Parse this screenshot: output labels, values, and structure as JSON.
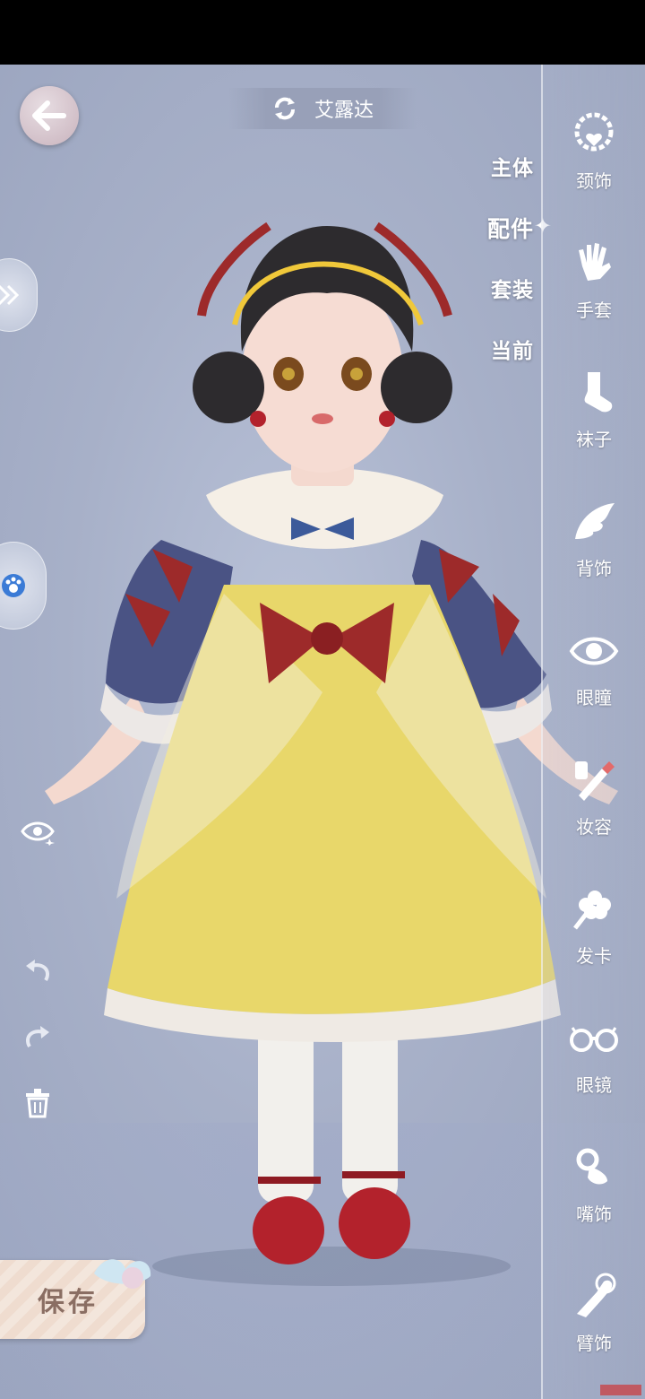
{
  "header": {
    "character_name": "艾露达"
  },
  "categories": [
    {
      "label": "主体",
      "active": false
    },
    {
      "label": "配件",
      "active": true
    },
    {
      "label": "套装",
      "active": false
    },
    {
      "label": "当前",
      "active": false
    }
  ],
  "rail": [
    {
      "label": "颈饰",
      "icon": "necklace-icon"
    },
    {
      "label": "手套",
      "icon": "glove-icon"
    },
    {
      "label": "袜子",
      "icon": "sock-icon"
    },
    {
      "label": "背饰",
      "icon": "wing-icon"
    },
    {
      "label": "眼瞳",
      "icon": "eye-icon"
    },
    {
      "label": "妆容",
      "icon": "makeup-brush-icon"
    },
    {
      "label": "发卡",
      "icon": "hairpin-flower-icon"
    },
    {
      "label": "眼镜",
      "icon": "glasses-icon"
    },
    {
      "label": "嘴饰",
      "icon": "pacifier-icon"
    },
    {
      "label": "臂饰",
      "icon": "arm-ornament-icon"
    }
  ],
  "actions": {
    "save_label": "保存"
  },
  "colors": {
    "accent_dress": "#e8d76a",
    "bow_red": "#9d2a2a",
    "sleeve_blue": "#4a5384"
  }
}
